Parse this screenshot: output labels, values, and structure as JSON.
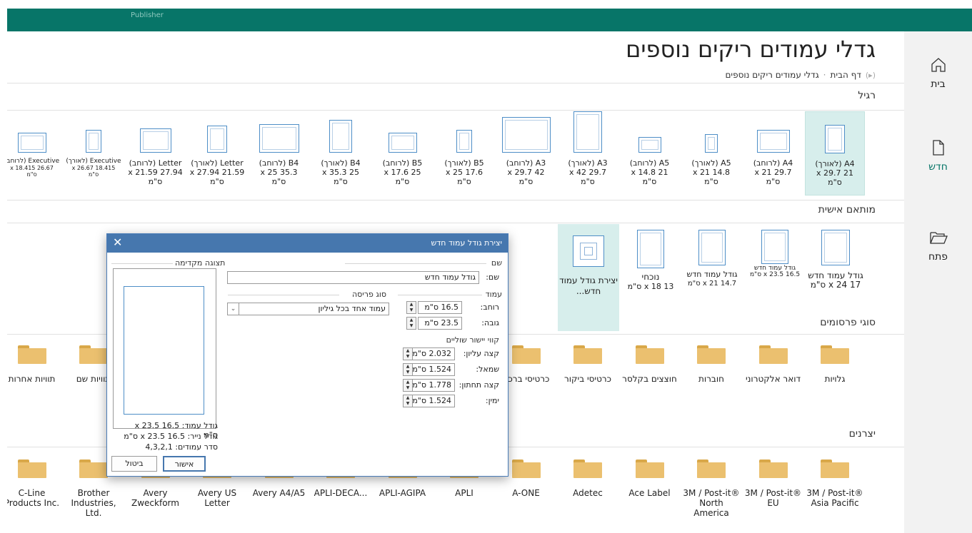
{
  "app": {
    "title": "Publisher"
  },
  "nav": {
    "home": "בית",
    "new": "חדש",
    "open": "פתח"
  },
  "page": {
    "title": "גדלי עמודים ריקים נוספים",
    "breadcrumb_home": "דף הבית",
    "breadcrumb_current": "גדלי עמודים ריקים נוספים"
  },
  "sections": {
    "standard": "רגיל",
    "custom": "מותאם אישית",
    "publication_types": "סוגי פרסומים",
    "manufacturers": "יצרנים"
  },
  "standard_sizes": [
    {
      "label": "A4 (לאורך)",
      "dims": "21 x 29.7",
      "unit": "ס\"מ",
      "selected": true
    },
    {
      "label": "A4 (לרוחב)",
      "dims": "29.7 x 21",
      "unit": "ס\"מ"
    },
    {
      "label": "A5 (לאורך)",
      "dims": "14.8 x 21",
      "unit": "ס\"מ"
    },
    {
      "label": "A5 (לרוחב)",
      "dims": "21 x 14.8",
      "unit": "ס\"מ"
    },
    {
      "label": "A3 (לאורך)",
      "dims": "29.7 x 42",
      "unit": "ס\"מ"
    },
    {
      "label": "A3 (לרוחב)",
      "dims": "42 x 29.7",
      "unit": "ס\"מ"
    },
    {
      "label": "B5 (לאורך)",
      "dims": "17.6 x 25",
      "unit": "ס\"מ"
    },
    {
      "label": "B5 (לרוחב)",
      "dims": "25 x 17.6",
      "unit": "ס\"מ"
    },
    {
      "label": "B4 (לאורך)",
      "dims": "25 x 35.3",
      "unit": "ס\"מ"
    },
    {
      "label": "B4 (לרוחב)",
      "dims": "35.3 x 25",
      "unit": "ס\"מ"
    },
    {
      "label": "Letter (לאורך)",
      "dims": "21.59 x 27.94",
      "unit": "ס\"מ"
    },
    {
      "label": "Letter (לרוחב)",
      "dims": "27.94 x 21.59",
      "unit": "ס\"מ"
    },
    {
      "label": "Executive (לאורך)",
      "dims": "18.415 x 26.67",
      "unit": "ס\"מ"
    },
    {
      "label": "Executive (לרוחב)",
      "dims": "26.67 x 18.415",
      "unit": "ס\"מ"
    }
  ],
  "custom_sizes": [
    {
      "label": "גודל עמוד חדש",
      "dims": "17 x 24 ס\"מ"
    },
    {
      "label": "גודל עמוד חדש",
      "dims": "16.5 x 23.5 ס\"מ"
    },
    {
      "label": "גודל עמוד חדש",
      "dims": "14.7 x 21 ס\"מ"
    },
    {
      "label": "נוכחי",
      "dims": "13 x 18 ס\"מ"
    },
    {
      "label": "יצירת גודל עמוד חדש...",
      "dims": ""
    }
  ],
  "publication_types": [
    "גלויות",
    "דואר אלקטרוני",
    "חוברות",
    "חוצצים בקלסר",
    "כרטיסי ביקור",
    "כרטיסי ברכה",
    "",
    "",
    "",
    "",
    "",
    "",
    "תוויות שם",
    "תוויות אחרות"
  ],
  "manufacturers": [
    "3M / Post-it® Asia Pacific",
    "3M / Post-it® EU",
    "3M / Post-it® North America",
    "Ace Label",
    "Adetec",
    "A-ONE",
    "APLI",
    "APLI-AGIPA",
    "APLI-DECA...",
    "Avery A4/A5",
    "Avery US Letter",
    "Avery Zweckform",
    "Brother Industries, Ltd.",
    "C-Line Products Inc."
  ],
  "dialog": {
    "title": "יצירת גודל עמוד חדש",
    "name_group": "שם",
    "name_label": "שם:",
    "name_value": "גודל עמוד חדש",
    "page_group": "עמוד",
    "width_label": "רוחב:",
    "width_value": "16.5 ס\"מ",
    "height_label": "גובה:",
    "height_value": "23.5 ס\"מ",
    "layout_group": "סוג פריסה",
    "layout_value": "עמוד אחד בכל גיליון",
    "margins_group": "קווי יישור שוליים",
    "top_label": "קצה עליון:",
    "top_value": "2.032 ס\"מ",
    "left_label": "שמאל:",
    "left_value": "1.524 ס\"מ",
    "bottom_label": "קצה תחתון:",
    "bottom_value": "1.778 ס\"מ",
    "right_label": "ימין:",
    "right_value": "1.524 ס\"מ",
    "preview_group": "תצוגה מקדימה",
    "page_size_info": "גודל עמוד: 16.5 x 23.5 ס\"מ",
    "paper_size_info": "גודל נייר: 16.5 x 23.5 ס\"מ",
    "page_order_info": "סדר עמודים: 4,3,2,1",
    "ok": "אישור",
    "cancel": "ביטול"
  }
}
